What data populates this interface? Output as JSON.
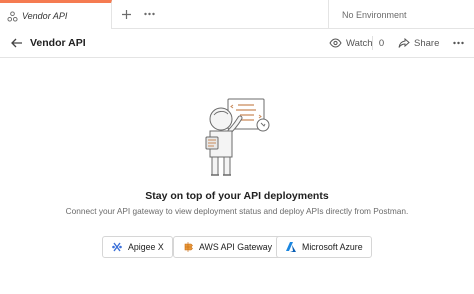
{
  "tab": {
    "label": "Vendor API"
  },
  "environment": {
    "label": "No Environment"
  },
  "header": {
    "title": "Vendor API",
    "watch_label": "Watch",
    "watch_count": "0",
    "share_label": "Share"
  },
  "empty_state": {
    "heading": "Stay on top of your API deployments",
    "description": "Connect your API gateway to view deployment status and deploy APIs directly from Postman."
  },
  "gateways": [
    {
      "label": "Apigee X"
    },
    {
      "label": "AWS API Gateway"
    },
    {
      "label": "Microsoft Azure"
    }
  ],
  "colors": {
    "accent": "#f57b51",
    "apigee": "#3a6fd8",
    "aws": "#c96a10",
    "azure": "#0a6fcf"
  }
}
